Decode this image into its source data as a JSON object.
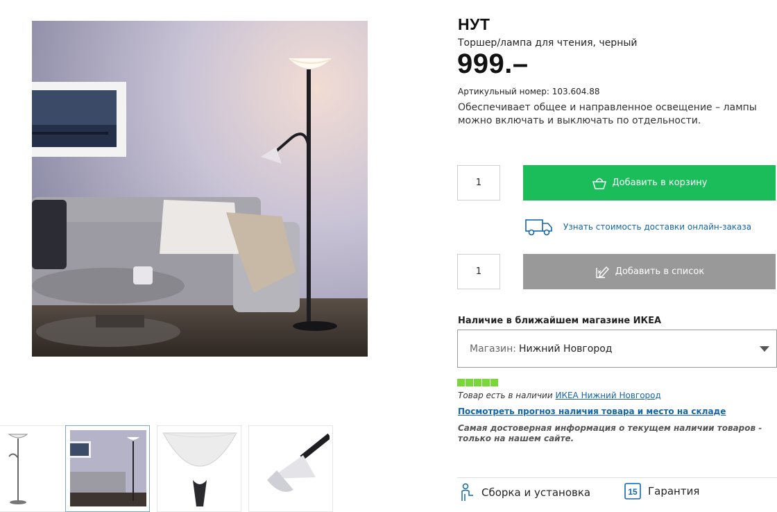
{
  "product": {
    "name": "НУТ",
    "subtitle": "Торшер/лампа для чтения, черный",
    "price": "999.–",
    "article_label": "Артикульный номер:",
    "article_number": "103.604.88",
    "description": "Обеспечивает общее и направленное освещение – лампы можно включать и выключать по отдельности."
  },
  "purchase": {
    "cart_quantity": "1",
    "add_to_cart_label": "Добавить в корзину",
    "delivery_link": "Узнать стоимость доставки онлайн-заказа",
    "list_quantity": "1",
    "add_to_list_label": "Добавить в список"
  },
  "availability": {
    "heading": "Наличие в ближайшем магазине ИКЕА",
    "store_prefix": "Магазин:",
    "store_value": "Нижний Новгород",
    "stock_level": 1.0,
    "stock_status_text": "Товар есть в наличии",
    "stock_store_link": "ИКЕА Нижний Новгород",
    "forecast_link": "Посмотреть прогноз наличия товара и место на складе",
    "info_note": "Самая достоверная информация о текущем наличии товаров - только на нашем сайте."
  },
  "footer": {
    "assembly_label": "Сборка и установка",
    "warranty_badge": "15",
    "warranty_label": "Гарантия"
  },
  "icons": {
    "cart": "basket-icon",
    "delivery": "truck-icon",
    "list": "pencil-list-icon",
    "dropdown": "chevron-down-icon",
    "assembly": "person-assembly-icon",
    "warranty": "warranty-badge-icon"
  },
  "colors": {
    "cart_button": "#1bbd5b",
    "list_button": "#999999",
    "link": "#1266ab",
    "stock_bar": "#7bd63b"
  }
}
